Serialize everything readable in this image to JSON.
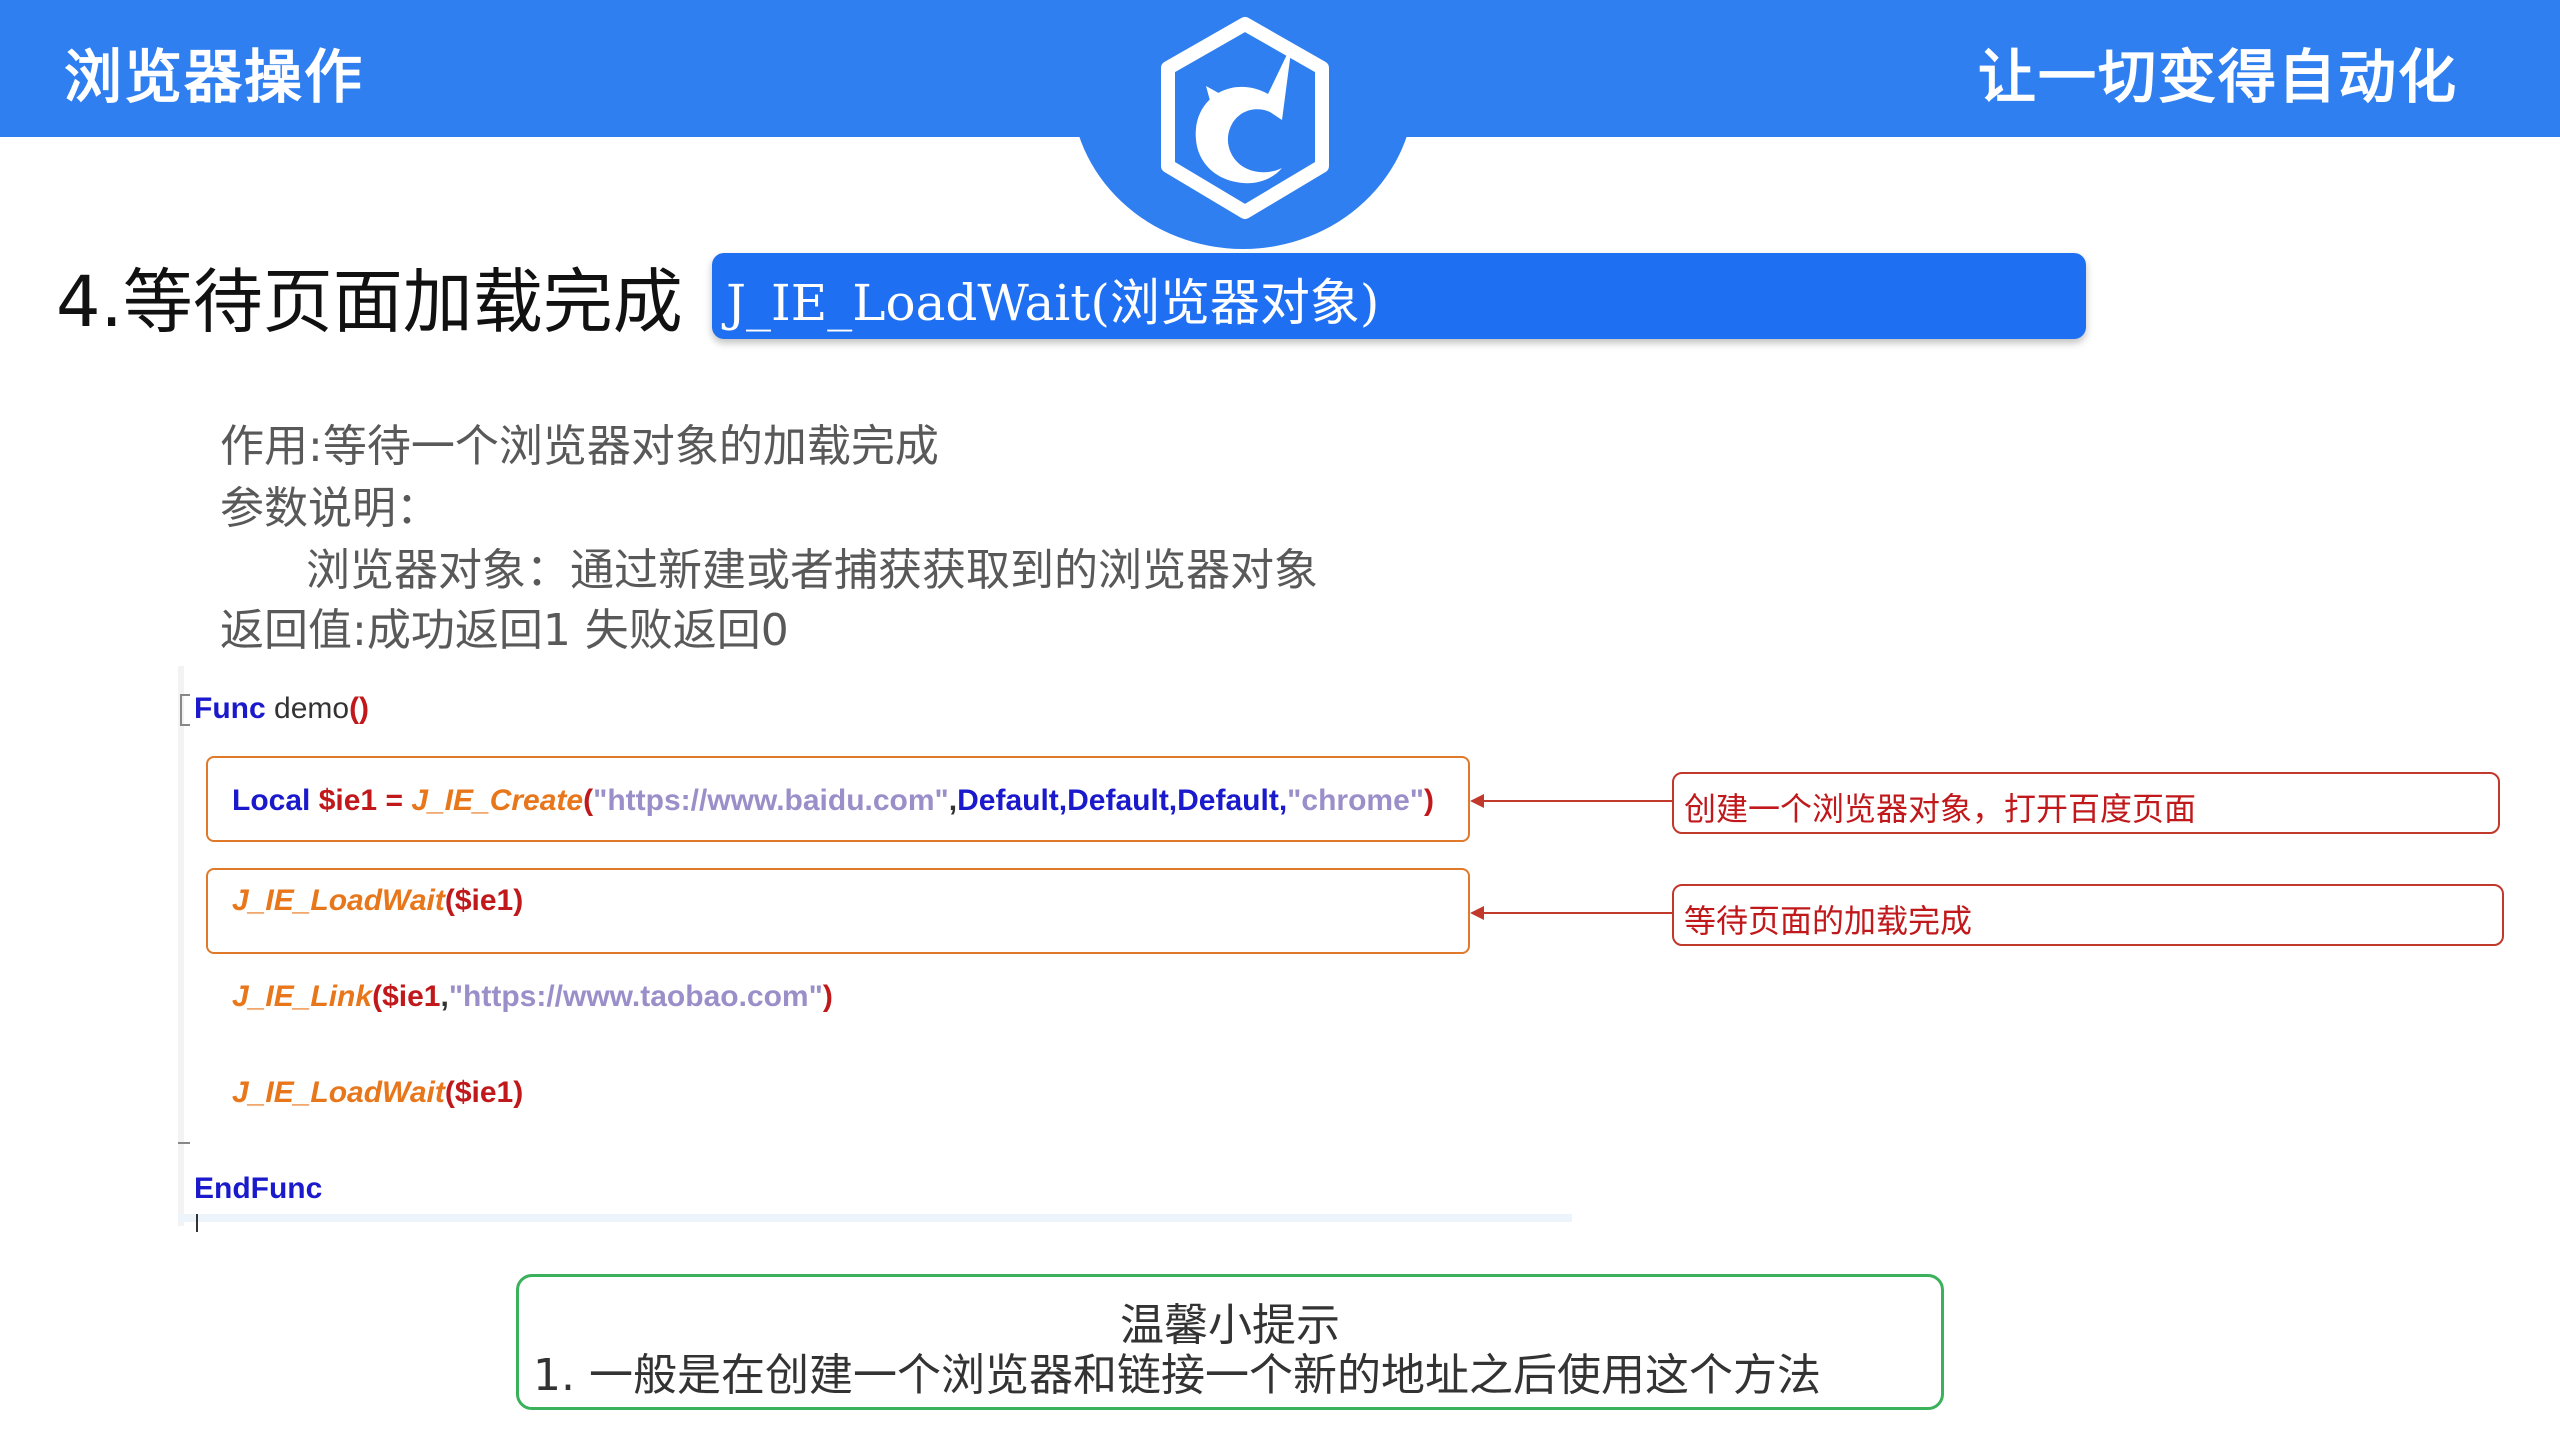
{
  "header": {
    "left_title": "浏览器操作",
    "right_title": "让一切变得自动化",
    "logo": "unicorn-logo-icon",
    "bar_color": "#2f7ff0"
  },
  "section": {
    "title": "4.等待页面加载完成",
    "function_signature": "J_IE_LoadWait(浏览器对象)"
  },
  "description": {
    "purpose": "作用:等待一个浏览器对象的加载完成",
    "params_label": "参数说明：",
    "param_detail": "浏览器对象：通过新建或者捕获获取到的浏览器对象",
    "return_value": "返回值:成功返回1 失败返回0"
  },
  "code": {
    "func_keyword": "Func",
    "func_name": "demo",
    "line1": {
      "keyword": "Local",
      "var": "$ie1",
      "eq": "=",
      "fn": "J_IE_Create",
      "arg1": "\"https://www.baidu.com\"",
      "defaults": "Default,Default,Default,",
      "arg2": "\"chrome\""
    },
    "line2": {
      "fn": "J_IE_LoadWait",
      "var": "$ie1"
    },
    "line3": {
      "fn": "J_IE_Link",
      "var": "$ie1",
      "arg": "\"https://www.taobao.com\""
    },
    "line4": {
      "fn": "J_IE_LoadWait",
      "var": "$ie1"
    },
    "end_keyword": "EndFunc"
  },
  "annotations": [
    {
      "text": "创建一个浏览器对象，打开百度页面"
    },
    {
      "text": "等待页面的加载完成"
    }
  ],
  "tip": {
    "title": "温馨小提示",
    "line1": "1. 一般是在创建一个浏览器和链接一个新的地址之后使用这个方法"
  }
}
